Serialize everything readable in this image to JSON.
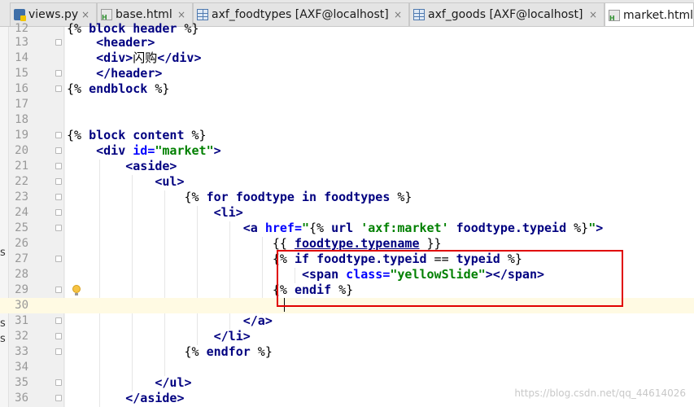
{
  "tabs": [
    {
      "label": "views.py",
      "icon": "python-file-icon",
      "close": "×"
    },
    {
      "label": "base.html",
      "icon": "html-file-icon",
      "close": "×"
    },
    {
      "label": "axf_foodtypes [AXF@localhost]",
      "icon": "table-icon",
      "close": "×"
    },
    {
      "label": "axf_goods [AXF@localhost]",
      "icon": "table-icon",
      "close": "×"
    },
    {
      "label": "market.html",
      "icon": "html-file-icon",
      "close": ""
    }
  ],
  "left_strip_chars": [
    "s",
    "s",
    "s"
  ],
  "editor": {
    "current_line": "30",
    "lines": [
      {
        "n": "12",
        "text": "{% block header %}"
      },
      {
        "n": "13",
        "text": "<header>"
      },
      {
        "n": "14",
        "text": "<div>闪购</div>"
      },
      {
        "n": "15",
        "text": "</header>"
      },
      {
        "n": "16",
        "text": "{% endblock %}"
      },
      {
        "n": "17",
        "text": ""
      },
      {
        "n": "18",
        "text": ""
      },
      {
        "n": "19",
        "text": "{% block content %}"
      },
      {
        "n": "20",
        "text": "<div id=\"market\">"
      },
      {
        "n": "21",
        "text": "<aside>"
      },
      {
        "n": "22",
        "text": "<ul>"
      },
      {
        "n": "23",
        "text": "{% for foodtype in foodtypes %}"
      },
      {
        "n": "24",
        "text": "<li>"
      },
      {
        "n": "25",
        "text": "<a href=\"{% url 'axf:market' foodtype.typeid %}\">"
      },
      {
        "n": "26",
        "text": "{{ foodtype.typename }}"
      },
      {
        "n": "27",
        "text": "{% if foodtype.typeid == typeid %}"
      },
      {
        "n": "28",
        "text": "<span class=\"yellowSlide\"></span>"
      },
      {
        "n": "29",
        "text": "{% endif %}"
      },
      {
        "n": "30",
        "text": ""
      },
      {
        "n": "31",
        "text": "</a>"
      },
      {
        "n": "32",
        "text": "</li>"
      },
      {
        "n": "33",
        "text": "{% endfor %}"
      },
      {
        "n": "34",
        "text": ""
      },
      {
        "n": "35",
        "text": "</ul>"
      },
      {
        "n": "36",
        "text": "</aside>"
      }
    ]
  },
  "watermark": "https://blog.csdn.net/qq_44614026",
  "colors": {
    "tag": "#000080",
    "attribute": "#0000ff",
    "string": "#008000",
    "highlight_box": "#e00000",
    "current_line": "#fffae3"
  }
}
